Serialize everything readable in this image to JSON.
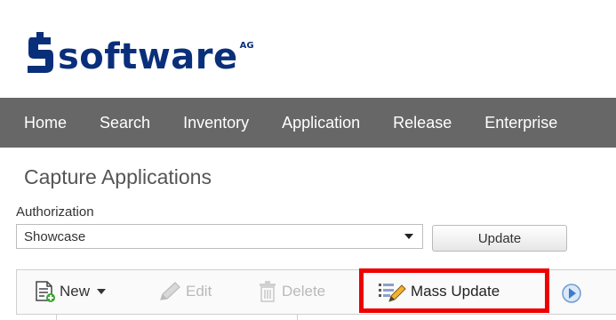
{
  "brand": {
    "name": "software",
    "suffix": "AG",
    "color": "#0a2f7a"
  },
  "nav": {
    "items": [
      {
        "label": "Home"
      },
      {
        "label": "Search"
      },
      {
        "label": "Inventory"
      },
      {
        "label": "Application"
      },
      {
        "label": "Release"
      },
      {
        "label": "Enterprise"
      }
    ],
    "background": "#676767"
  },
  "page": {
    "title": "Capture Applications"
  },
  "authorization": {
    "label": "Authorization",
    "selected": "Showcase",
    "update_label": "Update"
  },
  "toolbar": {
    "new_label": "New",
    "edit_label": "Edit",
    "delete_label": "Delete",
    "mass_update_label": "Mass Update",
    "highlight_color": "#ee0000",
    "icons": {
      "new": "new-document-icon",
      "edit": "pencil-icon",
      "delete": "trash-icon",
      "mass_update": "mass-edit-icon",
      "next": "arrow-right-circle-icon"
    }
  }
}
